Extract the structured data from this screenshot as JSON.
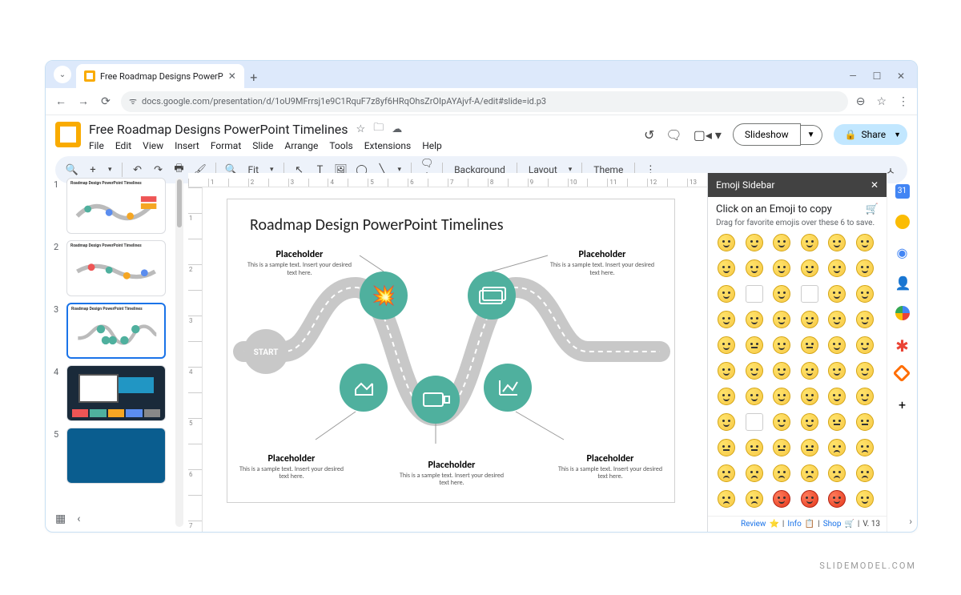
{
  "browser": {
    "tab_title": "Free Roadmap Designs PowerP",
    "url": "docs.google.com/presentation/d/1oU9MFrrsj1e9C1RquF7z8yf6HRqOhsZrOIpAYAjvf-A/edit#slide=id.p3"
  },
  "app": {
    "doc_title": "Free Roadmap Designs PowerPoint Timelines",
    "menus": [
      "File",
      "Edit",
      "View",
      "Insert",
      "Format",
      "Slide",
      "Arrange",
      "Tools",
      "Extensions",
      "Help"
    ],
    "slideshow": "Slideshow",
    "share": "Share"
  },
  "toolbar": {
    "zoom_label": "Fit",
    "background": "Background",
    "layout": "Layout",
    "theme": "Theme"
  },
  "thumbnails": {
    "title_prefix": "Roadmap Design PowerPoint Timelines",
    "items": [
      "1",
      "2",
      "3",
      "4",
      "5"
    ],
    "selected": 3
  },
  "slide": {
    "title": "Roadmap Design PowerPoint Timelines",
    "start": "START",
    "placeholder": "Placeholder",
    "sub": "This is a sample text. Insert your desired text here."
  },
  "sidebar": {
    "title": "Emoji Sidebar",
    "instruction": "Click on an Emoji to copy",
    "drag_hint": "Drag for favorite emojis over these 6 to save.",
    "footer_review": "Review",
    "footer_info": "Info",
    "footer_shop": "Shop",
    "footer_ver": "V. 13"
  },
  "ruler_h": [
    "",
    "1",
    "",
    "2",
    "",
    "3",
    "",
    "4",
    "",
    "5",
    "",
    "6",
    "",
    "7",
    "",
    "8",
    "",
    "9",
    "",
    "10",
    "",
    "11",
    "",
    "12",
    "",
    "13"
  ],
  "ruler_v": [
    "",
    "1",
    "",
    "2",
    "",
    "3",
    "",
    "4",
    "",
    "5",
    "",
    "6",
    "",
    "7"
  ],
  "watermark": "SLIDEMODEL.COM"
}
